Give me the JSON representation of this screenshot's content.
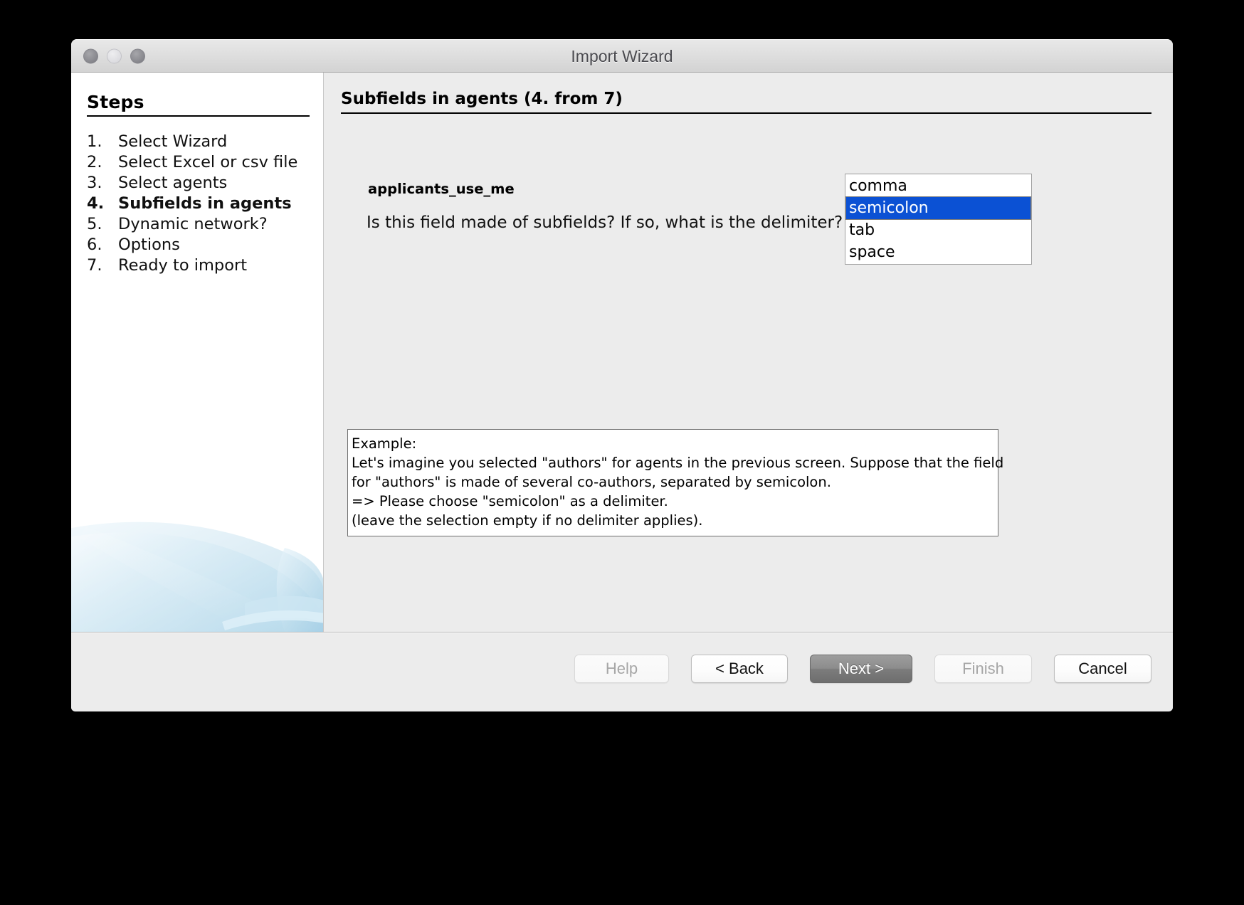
{
  "window": {
    "title": "Import Wizard",
    "controls": {
      "close": "close-button",
      "minimize": "minimize-button",
      "maximize": "maximize-button"
    }
  },
  "sidebar": {
    "heading": "Steps",
    "steps": [
      {
        "num": "1.",
        "label": "Select Wizard",
        "current": false
      },
      {
        "num": "2.",
        "label": "Select Excel or csv file",
        "current": false
      },
      {
        "num": "3.",
        "label": "Select agents",
        "current": false
      },
      {
        "num": "4.",
        "label": "Subfields in agents",
        "current": true
      },
      {
        "num": "5.",
        "label": "Dynamic network?",
        "current": false
      },
      {
        "num": "6.",
        "label": "Options",
        "current": false
      },
      {
        "num": "7.",
        "label": "Ready to import",
        "current": false
      }
    ]
  },
  "main": {
    "pane_title": "Subfields in agents (4. from  7)",
    "field_name": "applicants_use_me",
    "question": "Is this field made of subfields? If so, what is the delimiter?",
    "delimiter_list": {
      "options": [
        "comma",
        "semicolon",
        "tab",
        "space"
      ],
      "selected": "semicolon"
    },
    "example": {
      "line1": "Example:",
      "line2": "Let's imagine you selected \"authors\" for agents in the previous screen. Suppose that the field",
      "line3": "for \"authors\" is made of several co-authors, separated by semicolon.",
      "line4": "=> Please choose \"semicolon\" as a delimiter.",
      "line5": "(leave the selection empty if no delimiter applies)."
    }
  },
  "footer": {
    "buttons": [
      {
        "label": "Help",
        "state": "disabled"
      },
      {
        "label": "< Back",
        "state": "enabled"
      },
      {
        "label": "Next >",
        "state": "default"
      },
      {
        "label": "Finish",
        "state": "disabled"
      },
      {
        "label": "Cancel",
        "state": "enabled"
      }
    ]
  },
  "colors": {
    "selection_blue": "#0b51d4",
    "window_chrome": "#ececec",
    "sidebar_bg": "#ffffff",
    "graphic_blue": "#bcdcec"
  }
}
